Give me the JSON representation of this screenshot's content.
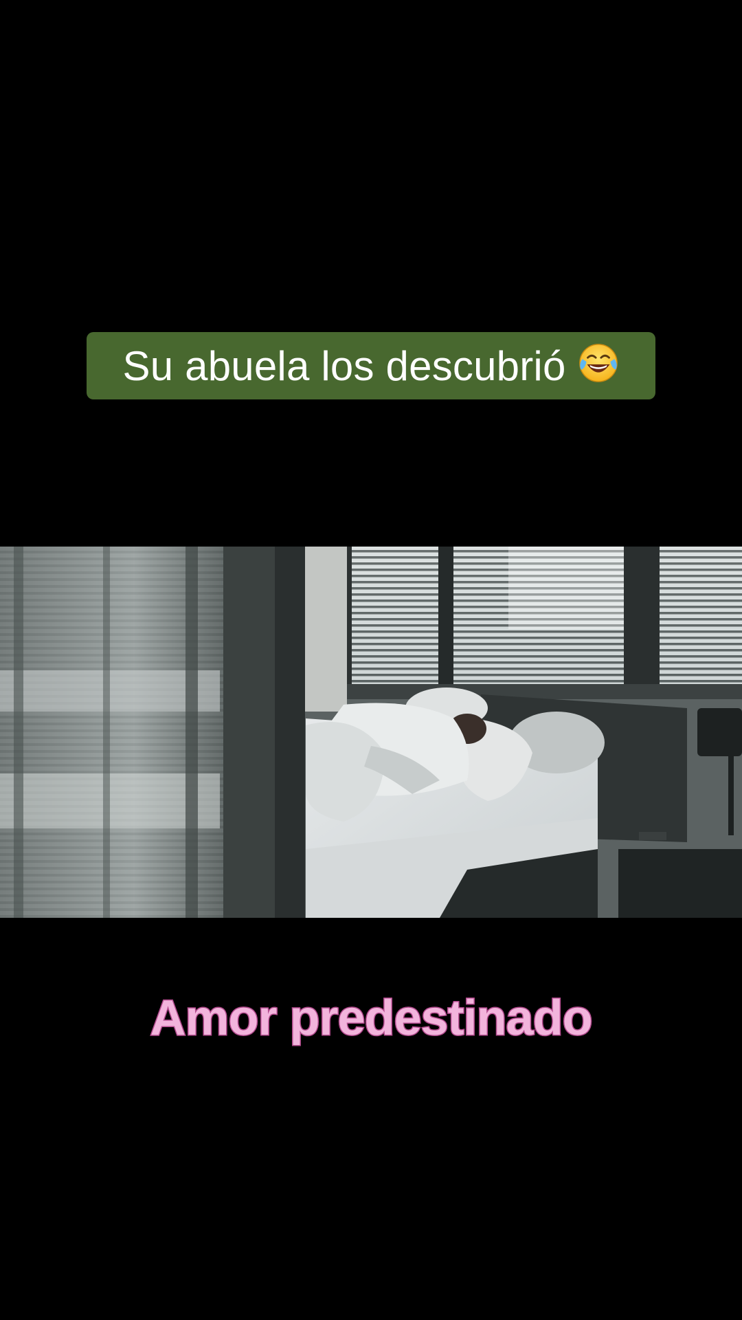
{
  "caption": {
    "text": "Su abuela los descubrió",
    "emoji": "face-with-tears-of-joy-icon",
    "background_color": "#48682f",
    "text_color": "#ffffff"
  },
  "video": {
    "scene": "bedroom-with-blinds"
  },
  "title_overlay": {
    "text": "Amor predestinado",
    "fill_color": "#f2b4dc",
    "outline_color": "#b44c8f"
  }
}
